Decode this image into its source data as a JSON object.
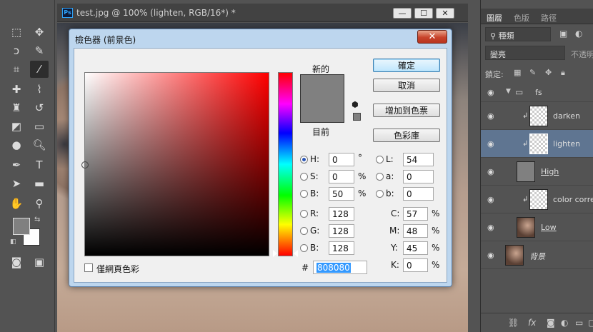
{
  "document": {
    "title": "test.jpg @ 100% (lighten, RGB/16*) *",
    "app_badge": "Ps",
    "window_buttons": [
      "—",
      "☐",
      "✕"
    ]
  },
  "dialog": {
    "title": "檢色器 (前景色)",
    "close_label": "✕",
    "new_label": "新的",
    "current_label": "目前",
    "new_color": "#808080",
    "current_color": "#808080",
    "buttons": {
      "ok": "確定",
      "cancel": "取消",
      "add_swatch": "增加到色票",
      "libraries": "色彩庫"
    },
    "fields": {
      "H": {
        "label": "H:",
        "value": "0",
        "unit": "°"
      },
      "S": {
        "label": "S:",
        "value": "0",
        "unit": "%"
      },
      "B": {
        "label": "B:",
        "value": "50",
        "unit": "%"
      },
      "R": {
        "label": "R:",
        "value": "128"
      },
      "G": {
        "label": "G:",
        "value": "128"
      },
      "B2": {
        "label": "B:",
        "value": "128"
      },
      "L": {
        "label": "L:",
        "value": "54"
      },
      "a": {
        "label": "a:",
        "value": "0"
      },
      "b": {
        "label": "b:",
        "value": "0"
      },
      "C": {
        "label": "C:",
        "value": "57",
        "unit": "%"
      },
      "M": {
        "label": "M:",
        "value": "48",
        "unit": "%"
      },
      "Y": {
        "label": "Y:",
        "value": "45",
        "unit": "%"
      },
      "K": {
        "label": "K:",
        "value": "0",
        "unit": "%"
      }
    },
    "hex_label": "#",
    "hex_value": "808080",
    "websafe_label": "僅網頁色彩",
    "selected_mode": "H"
  },
  "panel": {
    "tabs": [
      "圖層",
      "色版",
      "路徑"
    ],
    "filter_label": "種類",
    "blend_mode": "變亮",
    "opacity_label": "不透明",
    "lock_label": "鎖定:",
    "layers": [
      {
        "name": "fs",
        "type": "group"
      },
      {
        "name": "darken",
        "type": "clipped"
      },
      {
        "name": "lighten",
        "type": "clipped",
        "selected": true
      },
      {
        "name": "High",
        "type": "gray"
      },
      {
        "name": "color correct",
        "type": "clipped"
      },
      {
        "name": "Low",
        "type": "photo"
      },
      {
        "name": "背景",
        "type": "photo"
      }
    ],
    "footer_icons": [
      "link-icon",
      "fx-icon",
      "mask-icon",
      "adjustment-icon",
      "folder-icon",
      "new-layer-icon"
    ]
  },
  "toolbar": {
    "foreground_color": "#808080",
    "background_color": "#ffffff"
  }
}
